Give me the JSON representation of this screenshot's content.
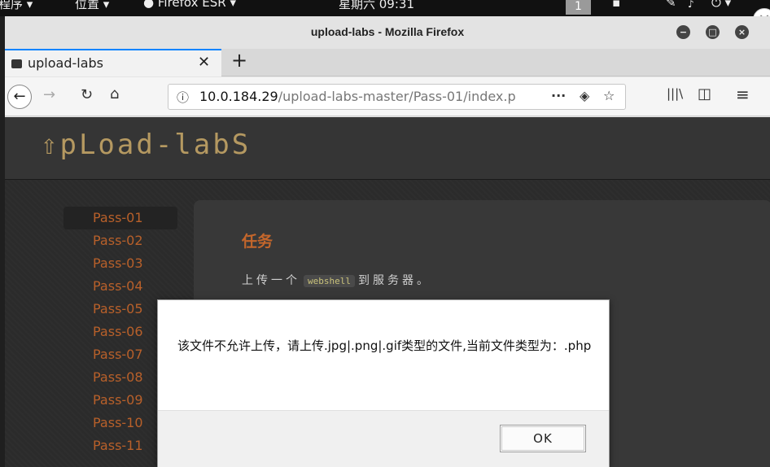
{
  "topbar": {
    "apps": "程序 ▾",
    "places": "位置 ▾",
    "app_menu": "Firefox ESR ▾",
    "clock": "星期六 09:31",
    "workspace": "1"
  },
  "window": {
    "title": "upload-labs - Mozilla Firefox"
  },
  "tab": {
    "label": "upload-labs"
  },
  "navbar": {
    "url_host": "10.0.184.29",
    "url_path": "/upload-labs-master/Pass-01/index.p"
  },
  "page": {
    "logo": "⇧pLoad-labS",
    "passes": [
      "Pass-01",
      "Pass-02",
      "Pass-03",
      "Pass-04",
      "Pass-05",
      "Pass-06",
      "Pass-07",
      "Pass-08",
      "Pass-09",
      "Pass-10",
      "Pass-11"
    ],
    "task_title": "任务",
    "task_prefix": "上传一个",
    "task_code": "webshell",
    "task_suffix": "到服务器。"
  },
  "dialog": {
    "message": "该文件不允许上传，请上传.jpg|.png|.gif类型的文件,当前文件类型为：.php",
    "ok_label": "OK"
  },
  "colors": {
    "accent": "#c4662b",
    "tab_highlight": "#0a84ff"
  }
}
